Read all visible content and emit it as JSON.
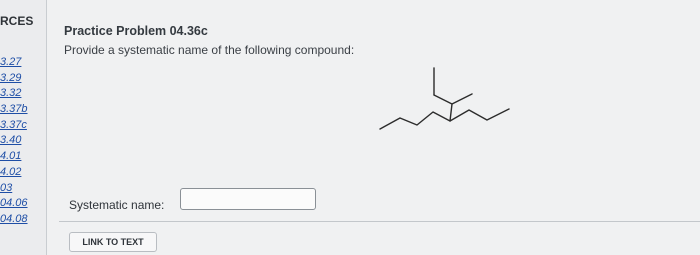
{
  "sidebar": {
    "heading": "RCES",
    "items": [
      {
        "label": "3.27"
      },
      {
        "label": "3.29"
      },
      {
        "label": "3.32"
      },
      {
        "label": "3.37b"
      },
      {
        "label": "3.37c"
      },
      {
        "label": "3.40"
      },
      {
        "label": "4.01"
      },
      {
        "label": "4.02"
      },
      {
        "label": "03"
      },
      {
        "label": "04.06"
      },
      {
        "label": "04.08"
      }
    ]
  },
  "problem": {
    "title": "Practice Problem 04.36c",
    "instructions": "Provide a systematic name of the following compound:"
  },
  "answer": {
    "label": "Systematic name:",
    "value": ""
  },
  "link_button": {
    "label": "LINK TO TEXT"
  },
  "colors": {
    "link": "#1e4ea6",
    "molecule_stroke": "#2c2c2c"
  },
  "icons": {
    "structure": "skeletal-formula"
  }
}
